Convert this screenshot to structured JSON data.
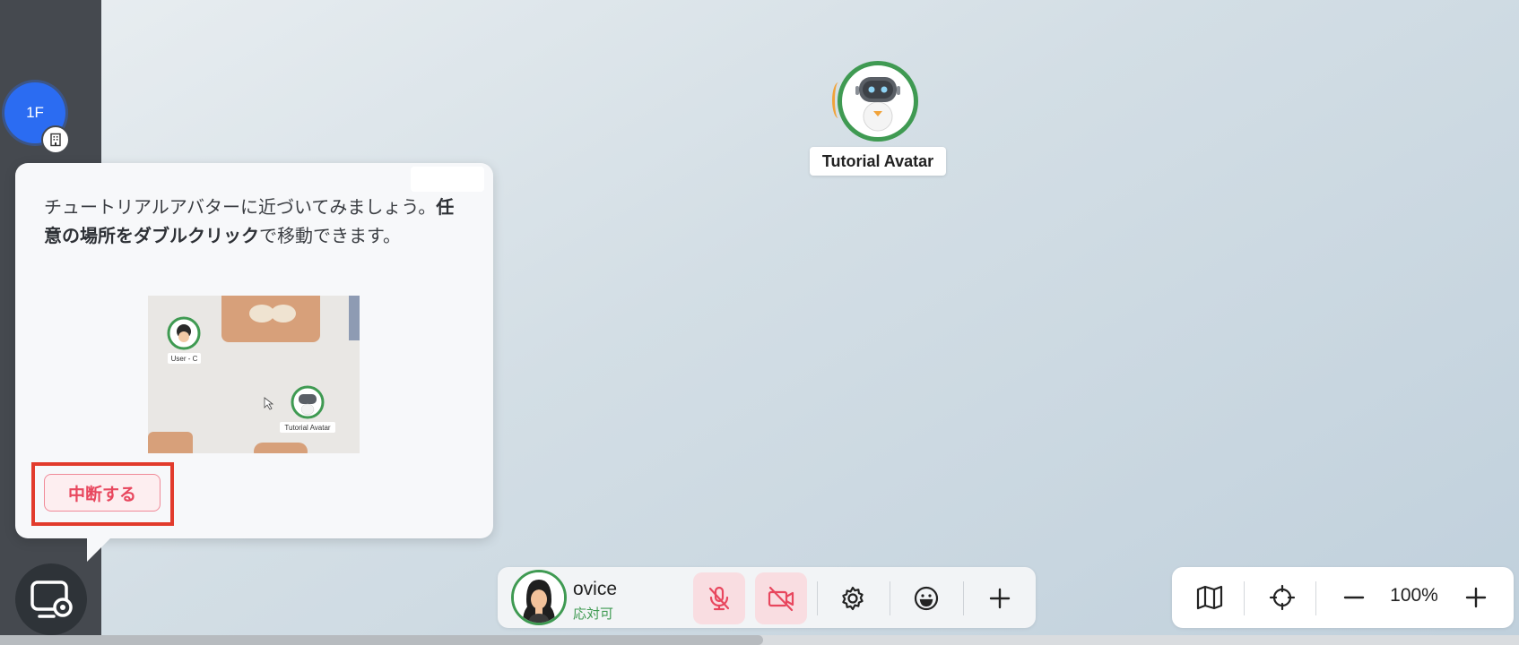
{
  "sidebar": {
    "floor_label": "1F",
    "floor_sub_icon": "building-icon",
    "bottom_icon": "screen-share-settings-icon"
  },
  "map": {
    "tutorial_avatar": {
      "name": "Tutorial Avatar",
      "icon": "robot-icon",
      "ring_color": "#3f9a52",
      "speaking_color": "#f1a33a"
    }
  },
  "tutorial": {
    "text_before": "チュートリアルアバターに近づいてみましょう。",
    "text_bold": "任意の場所をダブルクリック",
    "text_after": "で移動できます。",
    "image": {
      "user_label": "User - C",
      "avatar_label": "Tutorial Avatar"
    },
    "stop_label": "中断する"
  },
  "toolbar": {
    "user_name": "ovice",
    "user_status": "応対可",
    "mic_icon": "mic-off-icon",
    "camera_icon": "camera-off-icon",
    "settings_icon": "gear-icon",
    "reaction_icon": "emoji-icon",
    "add_icon": "plus-icon",
    "muted_bg": "#f9dde1",
    "muted_icon_color": "#e8475e"
  },
  "zoom": {
    "map_icon": "map-icon",
    "locate_icon": "crosshair-icon",
    "zoom_out_icon": "minus-icon",
    "level": "100%",
    "zoom_in_icon": "plus-icon"
  }
}
